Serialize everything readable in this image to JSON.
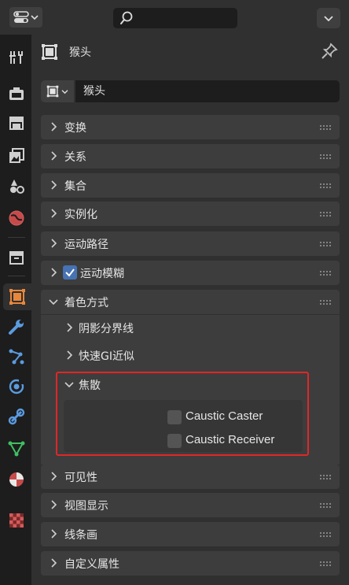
{
  "header": {
    "editor_type_icon": "properties-editor-icon",
    "search_placeholder": "",
    "options_icon": "chevron-down-icon"
  },
  "tabs": [
    {
      "name": "tool",
      "icon": "wrench-screwdriver-icon"
    },
    {
      "name": "render",
      "icon": "camera-back-icon"
    },
    {
      "name": "output",
      "icon": "printer-icon"
    },
    {
      "name": "view-layer",
      "icon": "image-stack-icon"
    },
    {
      "name": "scene",
      "icon": "scene-icon"
    },
    {
      "name": "world",
      "icon": "globe-icon"
    },
    {
      "name": "collection",
      "icon": "box-icon"
    },
    {
      "name": "object",
      "icon": "object-square-icon",
      "active": true
    },
    {
      "name": "modifiers",
      "icon": "wrench-icon"
    },
    {
      "name": "particles",
      "icon": "particles-icon"
    },
    {
      "name": "physics",
      "icon": "physics-orbit-icon"
    },
    {
      "name": "constraints",
      "icon": "constraint-icon"
    },
    {
      "name": "data",
      "icon": "mesh-triangle-icon"
    },
    {
      "name": "material",
      "icon": "material-sphere-icon"
    },
    {
      "name": "texture",
      "icon": "checker-texture-icon"
    }
  ],
  "object": {
    "name": "猴头",
    "field_value": "猴头"
  },
  "sections": {
    "transform": "变换",
    "relations": "关系",
    "collections": "集合",
    "instancing": "实例化",
    "motion_paths": "运动路径",
    "motion_blur": "运动模糊",
    "shading": "着色方式",
    "visibility": "可见性",
    "viewport_display": "视图显示",
    "line_art": "线条画",
    "custom_props": "自定义属性"
  },
  "shading": {
    "shadow_terminator": "阴影分界线",
    "fast_gi": "快速GI近似",
    "caustics": "焦散",
    "caustic_caster": "Caustic Caster",
    "caustic_receiver": "Caustic Receiver"
  },
  "state": {
    "motion_blur_checked": true,
    "caustic_caster_checked": false,
    "caustic_receiver_checked": false
  },
  "colors": {
    "accent": "#4772b3",
    "highlight_box": "#e02727",
    "object_orange": "#e8873c"
  }
}
